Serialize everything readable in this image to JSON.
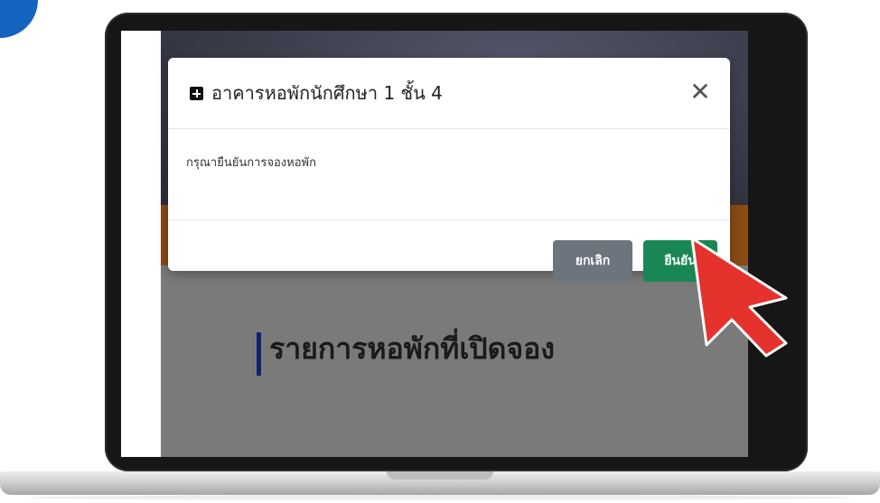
{
  "modal": {
    "title": "อาคารหอพักนักศึกษา 1 ชั้น 4",
    "message": "กรุณายืนยันการจองหอพัก",
    "close_glyph": "✕",
    "cancel_label": "ยกเลิก",
    "confirm_label": "ยืนยัน",
    "title_icon": "plus-square-icon"
  },
  "page": {
    "list_heading": "รายการหอพักที่เปิดจอง"
  },
  "colors": {
    "cancel_button": "#6c757d",
    "confirm_button": "#198754",
    "pointer": "#e5322d",
    "heading_accent": "#14206e"
  }
}
